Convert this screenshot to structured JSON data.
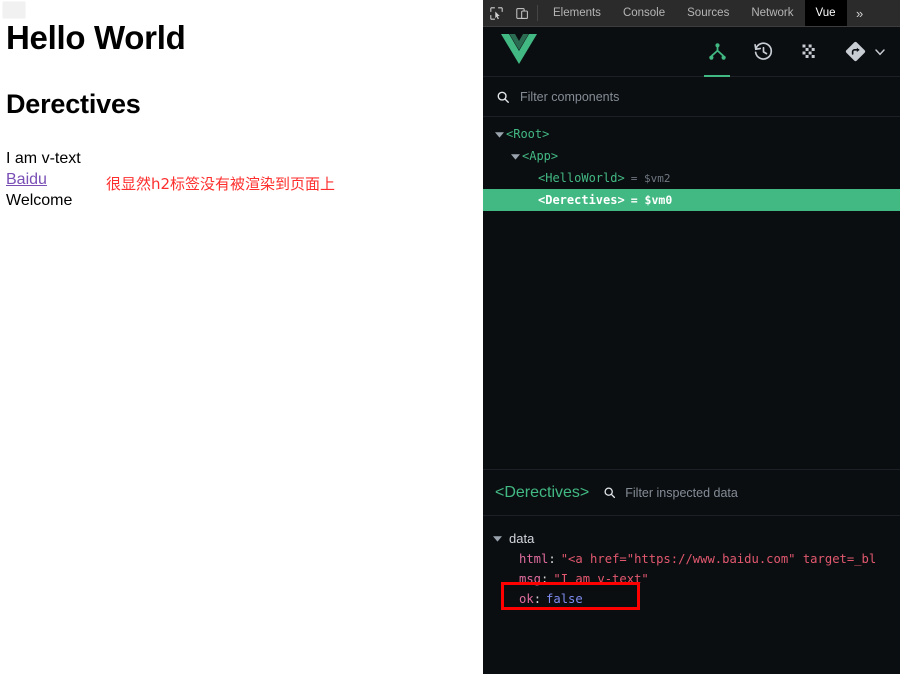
{
  "webpage": {
    "heading1": "Hello World",
    "heading3": "Derectives",
    "text_vtext": "I am v-text",
    "link_label": "Baidu",
    "text_welcome": "Welcome",
    "annotation": "很显然h2标签没有被渲染到页面上",
    "annotation_color": "#ff2e2e",
    "link_color": "#7a4fb5"
  },
  "devtools": {
    "tabs": [
      {
        "label": "Elements",
        "active": false
      },
      {
        "label": "Console",
        "active": false
      },
      {
        "label": "Sources",
        "active": false
      },
      {
        "label": "Network",
        "active": false
      },
      {
        "label": "Vue",
        "active": true
      }
    ],
    "overflow_label": "»",
    "icons": {
      "inspect": "inspect-element-icon",
      "device": "device-toolbar-icon"
    }
  },
  "vue_panel": {
    "logo": "vue-logo",
    "accent_color": "#42b883",
    "header_icons": [
      {
        "name": "components-tree-icon",
        "active": true
      },
      {
        "name": "timeline-history-icon",
        "active": false
      },
      {
        "name": "vuex-dots-icon",
        "active": false
      },
      {
        "name": "routes-diamond-icon",
        "active": false
      }
    ],
    "chevron": "chevron-down-icon",
    "filter": {
      "placeholder": "Filter components",
      "value": "",
      "icon": "search-icon"
    },
    "tree": [
      {
        "tag": "<Root>",
        "vm": "",
        "depth": 0,
        "expanded": true,
        "selected": false
      },
      {
        "tag": "<App>",
        "vm": "",
        "depth": 1,
        "expanded": true,
        "selected": false
      },
      {
        "tag": "<HelloWorld>",
        "vm": "= $vm2",
        "depth": 2,
        "expanded": false,
        "selected": false
      },
      {
        "tag": "<Derectives>",
        "vm": "= $vm0",
        "depth": 2,
        "expanded": false,
        "selected": true
      }
    ]
  },
  "inspector": {
    "component_name": "<Derectives>",
    "filter": {
      "placeholder": "Filter inspected data",
      "value": "",
      "icon": "search-icon"
    },
    "group_label": "data",
    "rows": [
      {
        "key": "html",
        "value": "\"<a href=\"https://www.baidu.com\" target=_bl",
        "type": "string",
        "highlighted": false
      },
      {
        "key": "msg",
        "value": "\"I am v-text\"",
        "type": "string",
        "highlighted": false
      },
      {
        "key": "ok",
        "value": "false",
        "type": "boolean",
        "highlighted": true
      }
    ],
    "highlight_color": "#ff0000"
  }
}
